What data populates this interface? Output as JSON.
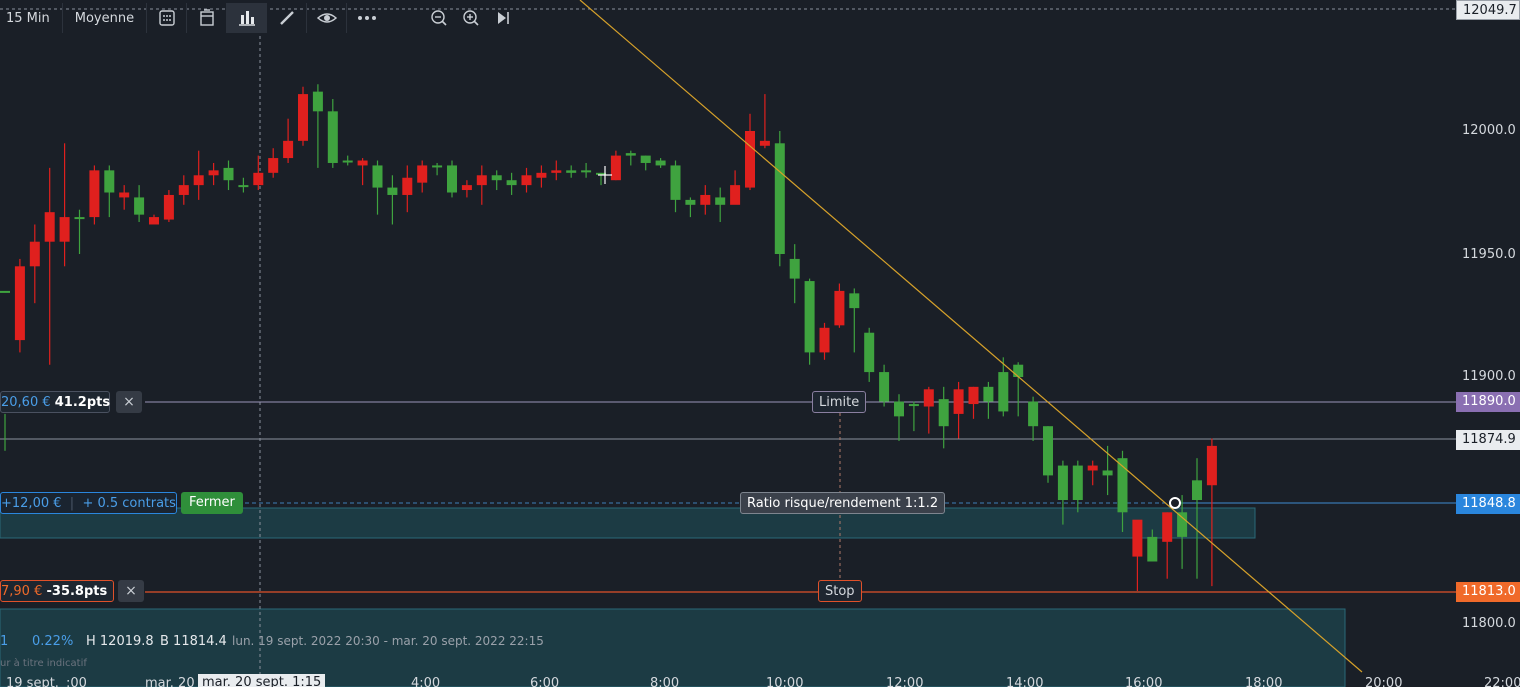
{
  "toolbar": {
    "interval": "15 Min",
    "average": "Moyenne"
  },
  "axis": {
    "prices": [
      "12049.7",
      "12000.0",
      "11950.0",
      "11900.0",
      "11800.0"
    ],
    "times": [
      ":00",
      "4:00",
      "6:00",
      "8:00",
      "10:00",
      "12:00",
      "14:00",
      "16:00",
      "18:00",
      "20:00",
      "22:00"
    ],
    "date_left": "19 sept.",
    "date_mid": "mar. 20",
    "date_cursor": "mar. 20 sept. 1:15"
  },
  "levels": {
    "limit_price": "11890.0",
    "current_price": "11874.9",
    "entry_price": "11848.8",
    "stop_price": "11813.0"
  },
  "orders": {
    "limit_value": "20,60 €",
    "limit_pts": "41.2pts",
    "limit_tag": "Limite",
    "entry_value": "+12,00 €",
    "entry_contracts": "+ 0.5 contrats",
    "close_button": "Fermer",
    "ratio": "Ratio risque/rendement 1:1.2",
    "stop_value": "7,90 €",
    "stop_pts": "-35.8pts",
    "stop_tag": "Stop",
    "close_x": "×"
  },
  "info": {
    "first": "1",
    "change": "0.22%",
    "high": "H 12019.8",
    "low": "B 11814.4",
    "range": "lun. 19 sept. 2022 20:30 - mar. 20 sept. 2022 22:15",
    "note": "ur à titre indicatif"
  },
  "colors": {
    "bg": "#1a1f27",
    "up": "#3fa33f",
    "down": "#e0201e",
    "trend": "#d6a12a",
    "limit": "#7b5ea7",
    "entry": "#1e7bd8",
    "stop": "#f06a2a",
    "zone": "#1f4f5a"
  },
  "chart_data": {
    "type": "candlestick",
    "candles": [
      [
        11935,
        11935,
        11885,
        11870
      ],
      [
        11945,
        11915,
        11948,
        11910
      ],
      [
        11955,
        11945,
        11962,
        11930
      ],
      [
        11967,
        11955,
        11985,
        11905
      ],
      [
        11965,
        11955,
        11995,
        11945
      ],
      [
        11965,
        11965,
        11968,
        11950
      ],
      [
        11984,
        11965,
        11986,
        11962
      ],
      [
        11975,
        11984,
        11986,
        11965
      ],
      [
        11975,
        11973,
        11978,
        11968
      ],
      [
        11966,
        11973,
        11978,
        11963
      ],
      [
        11965,
        11962,
        11966,
        11963
      ],
      [
        11974,
        11964,
        11976,
        11963
      ],
      [
        11978,
        11974,
        11982,
        11970
      ],
      [
        11982,
        11978,
        11992,
        11972
      ],
      [
        11984,
        11982,
        11987,
        11978
      ],
      [
        11980,
        11985,
        11988,
        11976
      ],
      [
        11978,
        11978,
        11981,
        11975
      ],
      [
        11983,
        11978,
        11990,
        11976
      ],
      [
        11989,
        11983,
        11993,
        11981
      ],
      [
        11996,
        11989,
        12005,
        11987
      ],
      [
        12015,
        11996,
        12018,
        11994
      ],
      [
        12008,
        12016,
        12019,
        11985
      ],
      [
        11987,
        12008,
        12013,
        11985
      ],
      [
        11988,
        11988,
        11990,
        11986
      ],
      [
        11988,
        11986,
        11989,
        11978
      ],
      [
        11977,
        11986,
        11988,
        11966
      ],
      [
        11974,
        11977,
        11982,
        11962
      ],
      [
        11981,
        11974,
        11986,
        11967
      ],
      [
        11986,
        11979,
        11988,
        11975
      ],
      [
        11986,
        11986,
        11987,
        11982
      ],
      [
        11975,
        11986,
        11988,
        11973
      ],
      [
        11978,
        11976,
        11980,
        11973
      ],
      [
        11982,
        11978,
        11986,
        11970
      ],
      [
        11980,
        11982,
        11984,
        11976
      ],
      [
        11978,
        11980,
        11983,
        11974
      ],
      [
        11982,
        11978,
        11985,
        11975
      ],
      [
        11983,
        11981,
        11986,
        11977
      ],
      [
        11984,
        11983,
        11988,
        11980
      ],
      [
        11983,
        11984,
        11986,
        11981
      ],
      [
        11984,
        11984,
        11987,
        11981
      ],
      [
        11983,
        11983,
        11983,
        11978
      ],
      [
        11990,
        11980,
        11992,
        11980
      ],
      [
        11990,
        11991,
        11992,
        11986
      ],
      [
        11987,
        11990,
        11990,
        11984
      ],
      [
        11986,
        11988,
        11989,
        11985
      ],
      [
        11972,
        11986,
        11988,
        11967
      ],
      [
        11970,
        11972,
        11973,
        11965
      ],
      [
        11974,
        11970,
        11978,
        11966
      ],
      [
        11970,
        11973,
        11977,
        11963
      ],
      [
        11978,
        11970,
        11984,
        11976
      ],
      [
        12000,
        11977,
        12007,
        11976
      ],
      [
        11996,
        11994,
        12015,
        11993
      ],
      [
        11950,
        11995,
        12000,
        11945
      ],
      [
        11940,
        11948,
        11954,
        11930
      ],
      [
        11910,
        11939,
        11940,
        11905
      ],
      [
        11920,
        11910,
        11922,
        11907
      ],
      [
        11935,
        11921,
        11938,
        11920
      ],
      [
        11928,
        11934,
        11936,
        11910
      ],
      [
        11902,
        11918,
        11920,
        11898
      ],
      [
        11890,
        11902,
        11905,
        11888
      ],
      [
        11884,
        11890,
        11893,
        11874
      ],
      [
        11889,
        11889,
        11890,
        11878
      ],
      [
        11895,
        11888,
        11896,
        11877
      ],
      [
        11880,
        11891,
        11896,
        11871
      ],
      [
        11895,
        11885,
        11898,
        11875
      ],
      [
        11896,
        11889,
        11896,
        11883
      ],
      [
        11890,
        11896,
        11898,
        11883
      ],
      [
        11886,
        11902,
        11908,
        11884
      ],
      [
        11900,
        11905,
        11906,
        11884
      ],
      [
        11880,
        11890,
        11892,
        11874
      ],
      [
        11860,
        11880,
        11880,
        11857
      ],
      [
        11850,
        11864,
        11866,
        11840
      ],
      [
        11850,
        11864,
        11866,
        11845
      ],
      [
        11864,
        11862,
        11866,
        11856
      ],
      [
        11860,
        11862,
        11872,
        11852
      ],
      [
        11845,
        11867,
        11870,
        11837
      ],
      [
        11842,
        11827,
        11835,
        11813
      ],
      [
        11825,
        11835,
        11838,
        11830
      ],
      [
        11845,
        11833,
        11845,
        11818
      ],
      [
        11835,
        11845,
        11852,
        11822
      ],
      [
        11850,
        11858,
        11867,
        11818
      ],
      [
        11872,
        11856,
        11875,
        11815
      ]
    ]
  }
}
